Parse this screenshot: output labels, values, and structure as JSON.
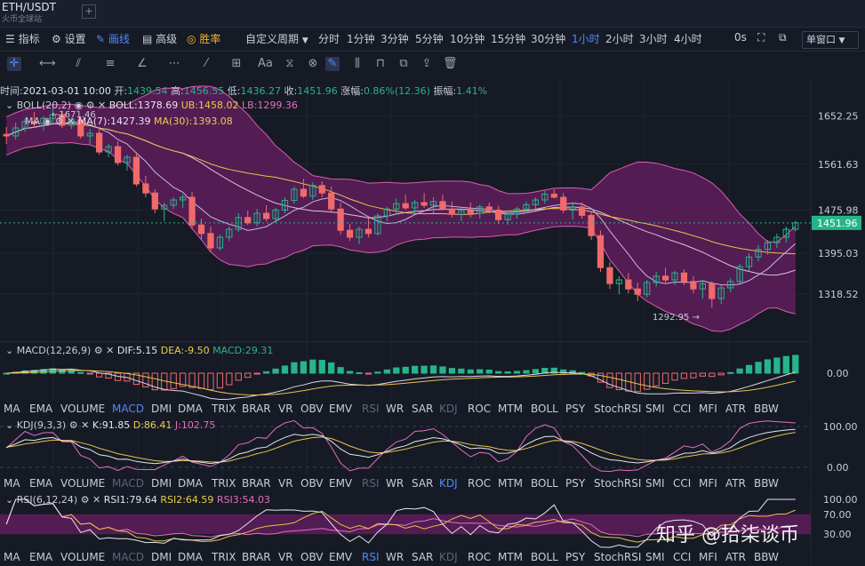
{
  "header": {
    "pair": "ETH/USDT",
    "exchange": "火币全球站",
    "add_tab": "+"
  },
  "toolbar": {
    "indicator": "指标",
    "settings": "设置",
    "draw": "画线",
    "advanced": "高级",
    "win_rate": "胜率",
    "custom_period": "自定义周期",
    "periods": [
      "分时",
      "1分钟",
      "3分钟",
      "5分钟",
      "10分钟",
      "15分钟",
      "30分钟",
      "1小时",
      "2小时",
      "3小时",
      "4小时"
    ],
    "active_period": "1小时",
    "zero_s": "0s",
    "window_mode": "单窗口"
  },
  "draw_tools": [
    "crosshair-icon",
    "horizontal-line-icon",
    "trend-line-icon",
    "channel-icon",
    "angle-icon",
    "fib-icon",
    "pattern-icon",
    "grid-icon",
    "text-tool-icon",
    "brush-icon",
    "magnet-icon",
    "ruler-icon",
    "pen-icon",
    "bars-icon",
    "lock-icon",
    "copy-icon",
    "export-icon",
    "trash-icon"
  ],
  "ohlc": {
    "time_label": "时间:",
    "time": "2021-03-01 10:00",
    "open_label": "开:",
    "open": "1439.54",
    "high_label": "高:",
    "high": "1456.55",
    "low_label": "低:",
    "low": "1436.27",
    "close_label": "收:",
    "close": "1451.96",
    "chg_label": "涨幅:",
    "chg": "0.86%(12.36)",
    "amp_label": "振幅:",
    "amp": "1.41%"
  },
  "boll": {
    "name": "BOLL(20,2)",
    "boll": "BOLL:1378.69",
    "ub": "UB:1458.02",
    "lb": "LB:1299.36"
  },
  "ma": {
    "name": "MA",
    "ma7": "MA(7):1427.39",
    "ma30": "MA(30):1393.08"
  },
  "macd": {
    "name": "MACD(12,26,9)",
    "dif": "DIF:5.15",
    "dea": "DEA:-9.50",
    "macd": "MACD:29.31"
  },
  "kdj": {
    "name": "KDJ(9,3,3)",
    "k": "K:91.85",
    "d": "D:86.41",
    "j": "J:102.75"
  },
  "rsi": {
    "name": "RSI(6,12,24)",
    "rsi1": "RSI1:79.64",
    "rsi2": "RSI2:64.59",
    "rsi3": "RSI3:54.03"
  },
  "indicator_tabs": [
    "MA",
    "EMA",
    "VOLUME",
    "MACD",
    "DMI",
    "DMA",
    "TRIX",
    "BRAR",
    "VR",
    "OBV",
    "EMV",
    "RSI",
    "WR",
    "SAR",
    "KDJ",
    "ROC",
    "MTM",
    "BOLL",
    "PSY",
    "StochRSI",
    "SMI",
    "CCI",
    "MFI",
    "ATR",
    "BBW"
  ],
  "price_axis": [
    "1652.25",
    "1561.63",
    "1475.98",
    "1395.03",
    "1318.52"
  ],
  "last_price": "1451.96",
  "annotations": {
    "high": "←1671.46",
    "low": "1292.95 →"
  },
  "macd_axis": [
    "0.00"
  ],
  "kdj_axis": [
    "100.00",
    "0.00"
  ],
  "rsi_axis": [
    "100.00",
    "70.00",
    "30.00"
  ],
  "watermark": "知乎 @拾柒谈币",
  "colors": {
    "up": "#26b58a",
    "down": "#f06a6a",
    "band": "#5e1d5c",
    "accent": "#4d8cf5"
  },
  "chart_data": {
    "type": "candlestick",
    "interval": "1小时",
    "ohlc": [
      [
        1618,
        1632,
        1600,
        1615
      ],
      [
        1615,
        1640,
        1608,
        1630
      ],
      [
        1630,
        1648,
        1622,
        1642
      ],
      [
        1642,
        1660,
        1630,
        1638
      ],
      [
        1638,
        1652,
        1625,
        1648
      ],
      [
        1648,
        1671,
        1640,
        1655
      ],
      [
        1655,
        1662,
        1630,
        1635
      ],
      [
        1635,
        1650,
        1628,
        1645
      ],
      [
        1645,
        1652,
        1610,
        1615
      ],
      [
        1615,
        1628,
        1598,
        1620
      ],
      [
        1620,
        1632,
        1580,
        1585
      ],
      [
        1585,
        1600,
        1575,
        1595
      ],
      [
        1595,
        1605,
        1560,
        1565
      ],
      [
        1565,
        1580,
        1550,
        1575
      ],
      [
        1575,
        1585,
        1520,
        1525
      ],
      [
        1525,
        1540,
        1500,
        1508
      ],
      [
        1508,
        1515,
        1470,
        1478
      ],
      [
        1478,
        1490,
        1455,
        1485
      ],
      [
        1485,
        1500,
        1478,
        1495
      ],
      [
        1495,
        1505,
        1480,
        1500
      ],
      [
        1500,
        1510,
        1440,
        1448
      ],
      [
        1448,
        1460,
        1420,
        1432
      ],
      [
        1432,
        1445,
        1398,
        1405
      ],
      [
        1405,
        1430,
        1400,
        1425
      ],
      [
        1425,
        1445,
        1418,
        1440
      ],
      [
        1440,
        1470,
        1435,
        1462
      ],
      [
        1462,
        1475,
        1448,
        1452
      ],
      [
        1452,
        1478,
        1445,
        1470
      ],
      [
        1470,
        1485,
        1455,
        1460
      ],
      [
        1460,
        1480,
        1452,
        1476
      ],
      [
        1476,
        1500,
        1470,
        1494
      ],
      [
        1494,
        1520,
        1488,
        1515
      ],
      [
        1515,
        1535,
        1498,
        1502
      ],
      [
        1502,
        1528,
        1495,
        1522
      ],
      [
        1522,
        1530,
        1500,
        1508
      ],
      [
        1508,
        1520,
        1470,
        1478
      ],
      [
        1478,
        1490,
        1430,
        1438
      ],
      [
        1438,
        1450,
        1418,
        1425
      ],
      [
        1425,
        1445,
        1412,
        1440
      ],
      [
        1440,
        1460,
        1425,
        1432
      ],
      [
        1432,
        1470,
        1428,
        1465
      ],
      [
        1465,
        1482,
        1455,
        1478
      ],
      [
        1478,
        1498,
        1470,
        1488
      ],
      [
        1488,
        1505,
        1476,
        1480
      ],
      [
        1480,
        1495,
        1468,
        1490
      ],
      [
        1490,
        1508,
        1480,
        1485
      ],
      [
        1485,
        1500,
        1470,
        1492
      ],
      [
        1492,
        1505,
        1475,
        1478
      ],
      [
        1478,
        1492,
        1462,
        1468
      ],
      [
        1468,
        1482,
        1455,
        1475
      ],
      [
        1475,
        1490,
        1462,
        1470
      ],
      [
        1470,
        1486,
        1460,
        1482
      ],
      [
        1482,
        1490,
        1470,
        1476
      ],
      [
        1476,
        1484,
        1450,
        1458
      ],
      [
        1458,
        1472,
        1448,
        1468
      ],
      [
        1468,
        1482,
        1460,
        1478
      ],
      [
        1478,
        1492,
        1470,
        1486
      ],
      [
        1486,
        1500,
        1478,
        1495
      ],
      [
        1495,
        1512,
        1488,
        1506
      ],
      [
        1506,
        1515,
        1498,
        1500
      ],
      [
        1500,
        1508,
        1470,
        1476
      ],
      [
        1476,
        1488,
        1458,
        1482
      ],
      [
        1482,
        1490,
        1460,
        1466
      ],
      [
        1466,
        1472,
        1420,
        1428
      ],
      [
        1428,
        1438,
        1360,
        1368
      ],
      [
        1368,
        1378,
        1328,
        1338
      ],
      [
        1338,
        1352,
        1318,
        1345
      ],
      [
        1345,
        1358,
        1320,
        1328
      ],
      [
        1328,
        1340,
        1305,
        1318
      ],
      [
        1318,
        1345,
        1312,
        1340
      ],
      [
        1340,
        1360,
        1332,
        1352
      ],
      [
        1352,
        1368,
        1340,
        1345
      ],
      [
        1345,
        1362,
        1335,
        1358
      ],
      [
        1358,
        1365,
        1335,
        1342
      ],
      [
        1342,
        1352,
        1320,
        1328
      ],
      [
        1328,
        1345,
        1310,
        1338
      ],
      [
        1338,
        1342,
        1293,
        1310
      ],
      [
        1310,
        1335,
        1300,
        1330
      ],
      [
        1330,
        1348,
        1322,
        1342
      ],
      [
        1342,
        1375,
        1338,
        1370
      ],
      [
        1370,
        1395,
        1362,
        1388
      ],
      [
        1388,
        1410,
        1380,
        1402
      ],
      [
        1402,
        1420,
        1392,
        1415
      ],
      [
        1415,
        1432,
        1405,
        1425
      ],
      [
        1425,
        1445,
        1415,
        1440
      ],
      [
        1440,
        1456,
        1436,
        1452
      ]
    ],
    "price_axis_ticks": [
      1652.25,
      1561.63,
      1475.98,
      1395.03,
      1318.52
    ],
    "ylim": [
      1240,
      1710
    ],
    "annotations": [
      {
        "text": "1671.46",
        "type": "high"
      },
      {
        "text": "1292.95",
        "type": "low"
      }
    ],
    "indicators": {
      "BOLL(20,2)": {
        "BOLL": 1378.69,
        "UB": 1458.02,
        "LB": 1299.36
      },
      "MA(7)": 1427.39,
      "MA(30)": 1393.08,
      "MACD(12,26,9)": {
        "DIF": 5.15,
        "DEA": -9.5,
        "MACD": 29.31
      },
      "KDJ(9,3,3)": {
        "K": 91.85,
        "D": 86.41,
        "J": 102.75
      },
      "RSI(6,12,24)": {
        "RSI1": 79.64,
        "RSI2": 64.59,
        "RSI3": 54.03
      }
    }
  }
}
